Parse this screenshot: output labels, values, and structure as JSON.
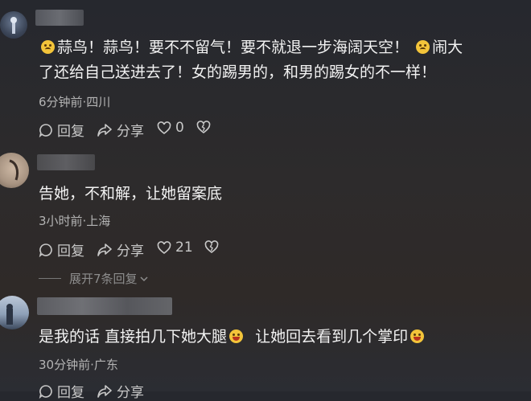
{
  "comments": [
    {
      "line1_a": "蒜鸟！蒜鸟！要不不留气！要不就退一步海阔天空！",
      "line1_b": "闹大",
      "line2": "了还给自己送进去了！女的踢男的，和男的踢女的不一样！",
      "time": "6分钟前·四川",
      "reply": "回复",
      "share": "分享",
      "likes": "0"
    },
    {
      "text": "告她，不和解，让她留案底",
      "time": "3小时前·上海",
      "reply": "回复",
      "share": "分享",
      "likes": "21",
      "expand": "展开7条回复"
    },
    {
      "text_a": "是我的话  直接拍几下她大腿",
      "text_b": "让她回去看到几个掌印",
      "time": "30分钟前·广东",
      "reply": "回复",
      "share": "分享"
    }
  ],
  "icons": {
    "reply": "reply-bubble-icon",
    "share": "share-arrow-icon",
    "like": "heart-icon",
    "dislike": "broken-heart-icon",
    "expand": "chevron-down-icon"
  }
}
